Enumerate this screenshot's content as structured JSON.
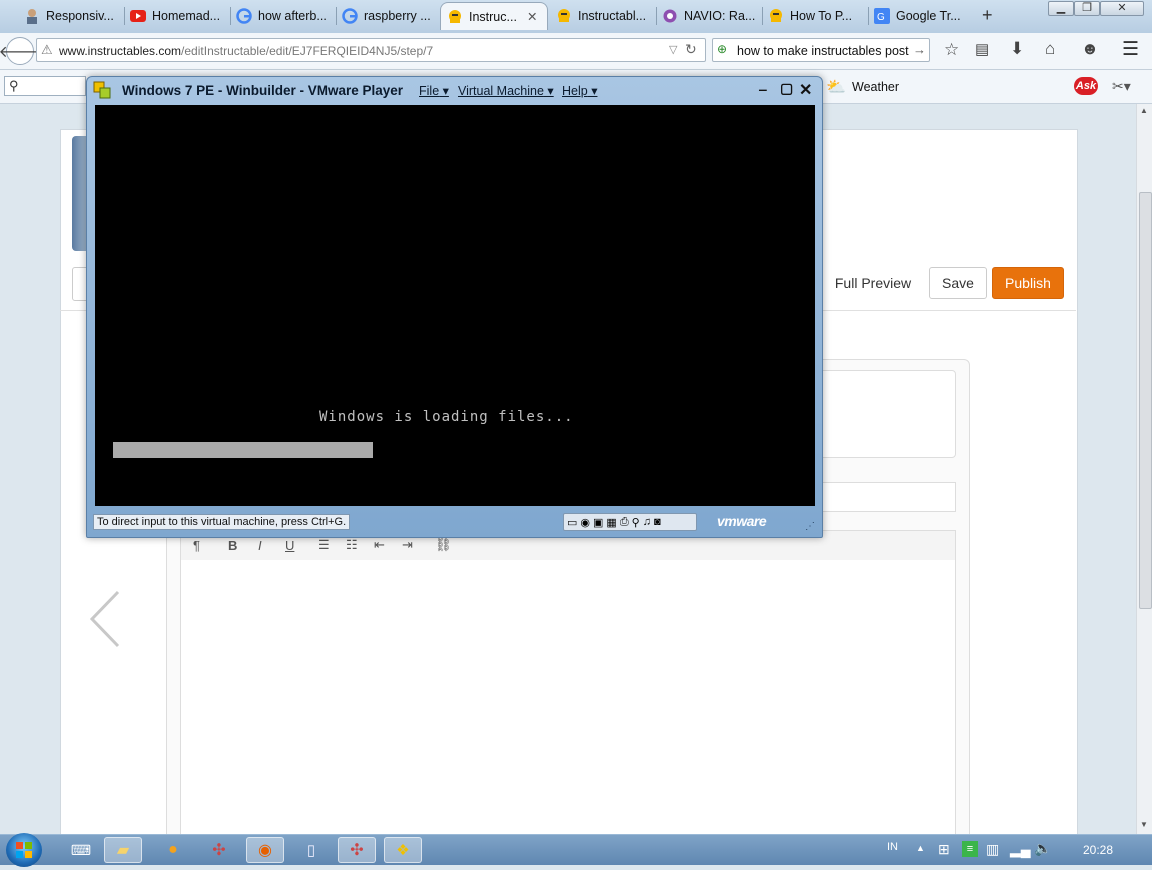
{
  "browser": {
    "tabs": [
      {
        "label": "Responsiv...",
        "icon": "person-icon"
      },
      {
        "label": "Homemad...",
        "icon": "youtube-icon"
      },
      {
        "label": "how afterb...",
        "icon": "google-icon"
      },
      {
        "label": "raspberry ...",
        "icon": "google-icon"
      },
      {
        "label": "Instruc...",
        "icon": "instructables-icon",
        "active": true
      },
      {
        "label": "Instructabl...",
        "icon": "instructables-icon"
      },
      {
        "label": "NAVIO: Ra...",
        "icon": "navio-icon"
      },
      {
        "label": "How To P...",
        "icon": "instructables-icon"
      },
      {
        "label": "Google Tr...",
        "icon": "google-translate-icon"
      }
    ],
    "new_tab": "+",
    "url_domain": "www.instructables.com",
    "url_path": "/editInstructable/edit/EJ7FERQIEID4NJ5/step/7",
    "search_value": "how to make instructables post",
    "weather_label": "Weather"
  },
  "page": {
    "full_preview": "Full Preview",
    "save": "Save",
    "publish": "Publish",
    "publish_color": "#e8720c"
  },
  "vmware": {
    "title": "Windows 7 PE - Winbuilder - VMware Player",
    "menus": [
      "File",
      "Virtual Machine",
      "Help"
    ],
    "screen_text": "Windows is loading files...",
    "progress": 0.38,
    "status": "To direct input to this virtual machine, press Ctrl+G.",
    "logo": "vmware"
  },
  "editor": {
    "tools": [
      "¶",
      "B",
      "I",
      "U"
    ]
  },
  "taskbar": {
    "lang": "IN",
    "time": "20:28"
  }
}
